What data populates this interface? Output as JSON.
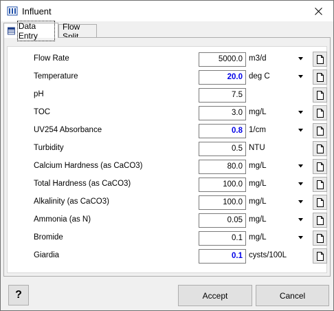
{
  "window": {
    "title": "Influent",
    "close_icon": "close-icon"
  },
  "tabs": [
    {
      "label": "Data Entry",
      "active": true
    },
    {
      "label": "Flow Split",
      "active": false
    }
  ],
  "rows": [
    {
      "label": "Flow Rate",
      "value": "5000.0",
      "unit": "m3/d",
      "highlight": false,
      "has_dropdown": true
    },
    {
      "label": "Temperature",
      "value": "20.0",
      "unit": "deg C",
      "highlight": true,
      "has_dropdown": true
    },
    {
      "label": "pH",
      "value": "7.5",
      "unit": "",
      "highlight": false,
      "has_dropdown": false
    },
    {
      "label": "TOC",
      "value": "3.0",
      "unit": "mg/L",
      "highlight": false,
      "has_dropdown": true
    },
    {
      "label": "UV254 Absorbance",
      "value": "0.8",
      "unit": "1/cm",
      "highlight": true,
      "has_dropdown": true
    },
    {
      "label": "Turbidity",
      "value": "0.5",
      "unit": "NTU",
      "highlight": false,
      "has_dropdown": false
    },
    {
      "label": "Calcium Hardness (as CaCO3)",
      "value": "80.0",
      "unit": "mg/L",
      "highlight": false,
      "has_dropdown": true
    },
    {
      "label": "Total Hardness (as CaCO3)",
      "value": "100.0",
      "unit": "mg/L",
      "highlight": false,
      "has_dropdown": true
    },
    {
      "label": "Alkalinity (as CaCO3)",
      "value": "100.0",
      "unit": "mg/L",
      "highlight": false,
      "has_dropdown": true
    },
    {
      "label": "Ammonia (as N)",
      "value": "0.05",
      "unit": "mg/L",
      "highlight": false,
      "has_dropdown": true
    },
    {
      "label": "Bromide",
      "value": "0.1",
      "unit": "mg/L",
      "highlight": false,
      "has_dropdown": true
    },
    {
      "label": "Giardia",
      "value": "0.1",
      "unit": "cysts/100L",
      "highlight": true,
      "has_dropdown": false
    }
  ],
  "footer": {
    "help_label": "?",
    "accept_label": "Accept",
    "cancel_label": "Cancel"
  },
  "colors": {
    "highlight_value": "#0000e6",
    "window_bg": "#f0f0f0"
  }
}
